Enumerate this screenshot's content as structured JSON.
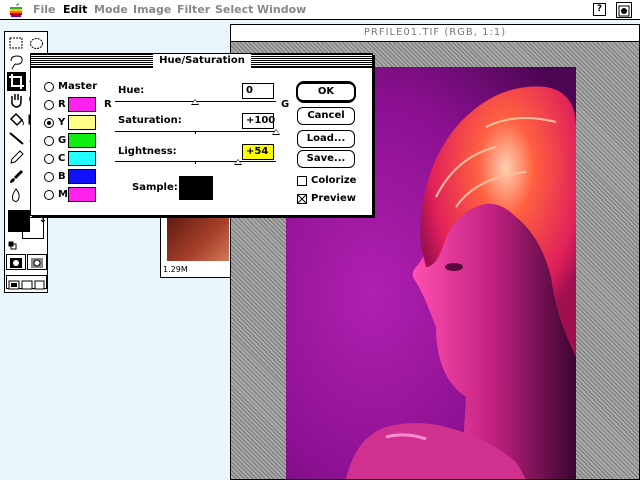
{
  "menubar": {
    "items": [
      {
        "label": "File",
        "active": false
      },
      {
        "label": "Edit",
        "active": true
      },
      {
        "label": "Mode",
        "active": false
      },
      {
        "label": "Image",
        "active": false
      },
      {
        "label": "Filter",
        "active": false
      },
      {
        "label": "Select",
        "active": false
      },
      {
        "label": "Window",
        "active": false
      }
    ],
    "help_icon": "?"
  },
  "document": {
    "title": "PRFILE01.TIF (RGB, 1:1)",
    "thumb_size": "1.29M"
  },
  "dialog": {
    "title": "Hue/Saturation",
    "channels": [
      {
        "label": "Master",
        "selected": false,
        "color": ""
      },
      {
        "label": "R",
        "selected": false,
        "color": "#ff22ee"
      },
      {
        "label": "Y",
        "selected": true,
        "color": "#ffff88"
      },
      {
        "label": "G",
        "selected": false,
        "color": "#11ee11"
      },
      {
        "label": "C",
        "selected": false,
        "color": "#22ffff"
      },
      {
        "label": "B",
        "selected": false,
        "color": "#1111ff"
      },
      {
        "label": "M",
        "selected": false,
        "color": "#ff22ee"
      }
    ],
    "hue": {
      "label": "Hue:",
      "value": "0",
      "left_end": "R",
      "right_end": "G",
      "level": 0.5
    },
    "saturation": {
      "label": "Saturation:",
      "value": "+100",
      "level": 1.0
    },
    "lightness": {
      "label": "Lightness:",
      "value": "+54",
      "level": 0.77,
      "highlight": "#ffff00"
    },
    "sample_label": "Sample:",
    "sample_color": "#000000",
    "buttons": {
      "ok": "OK",
      "cancel": "Cancel",
      "load": "Load...",
      "save": "Save..."
    },
    "colorize": {
      "label": "Colorize",
      "checked": false
    },
    "preview": {
      "label": "Preview",
      "checked": true
    }
  },
  "toolbox": {
    "foreground_color": "#000000",
    "background_color": "#ffffff"
  }
}
